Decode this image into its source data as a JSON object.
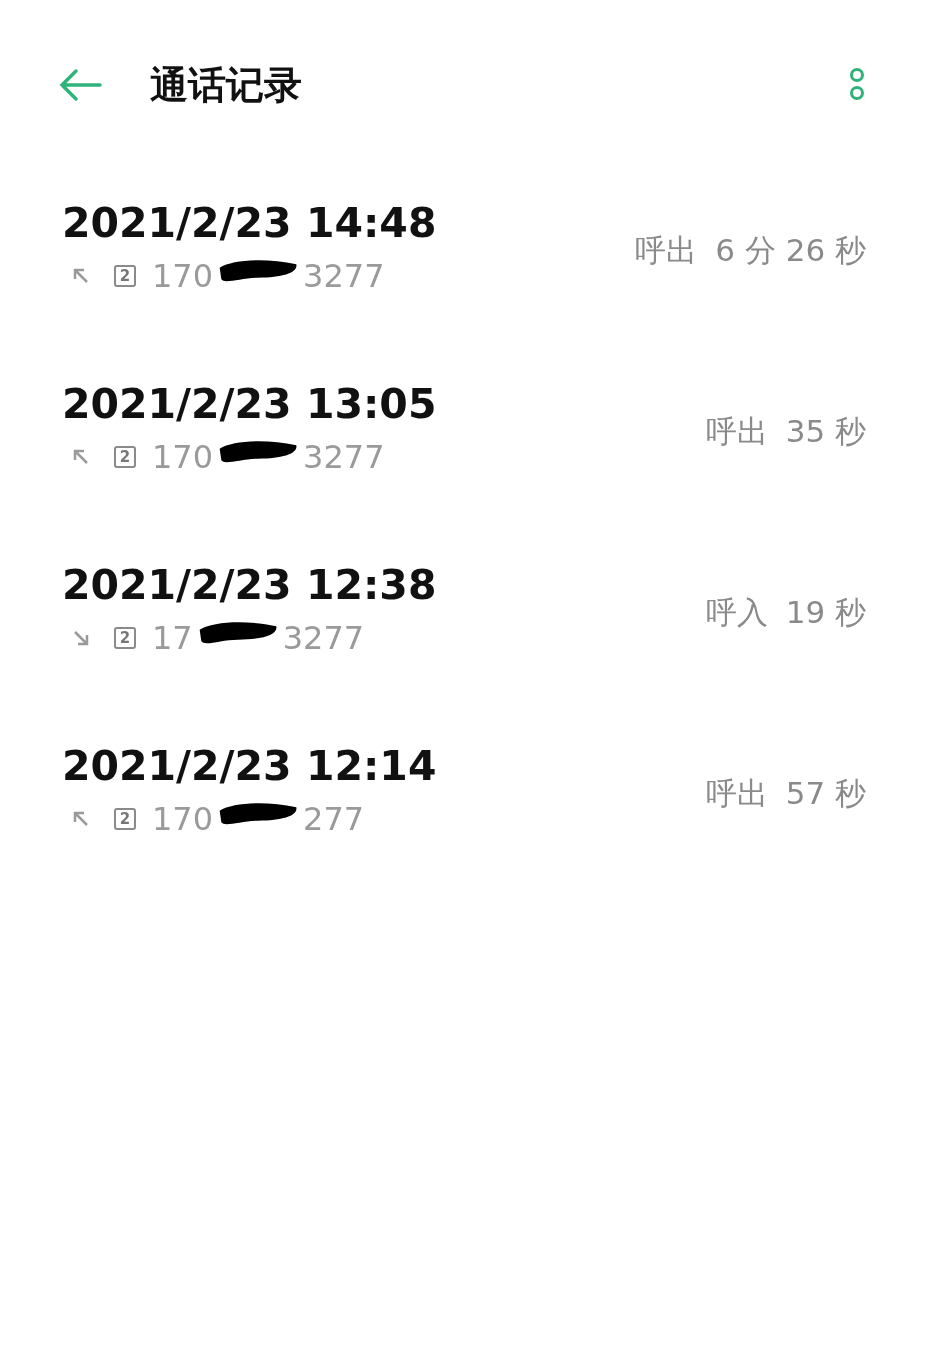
{
  "header": {
    "title": "通话记录"
  },
  "calls": [
    {
      "datetime": "2021/2/23 14:48",
      "kind": "outgoing",
      "sim": "2",
      "number_start": "170",
      "number_end": "3277",
      "call_type": "呼出",
      "duration": "6 分 26 秒"
    },
    {
      "datetime": "2021/2/23 13:05",
      "kind": "outgoing",
      "sim": "2",
      "number_start": "170",
      "number_end": "3277",
      "call_type": "呼出",
      "duration": "35 秒"
    },
    {
      "datetime": "2021/2/23 12:38",
      "kind": "incoming",
      "sim": "2",
      "number_start": "17",
      "number_end": "3277",
      "call_type": "呼入",
      "duration": "19 秒"
    },
    {
      "datetime": "2021/2/23 12:14",
      "kind": "outgoing",
      "sim": "2",
      "number_start": "170",
      "number_end": "277",
      "call_type": "呼出",
      "duration": "57 秒"
    }
  ]
}
